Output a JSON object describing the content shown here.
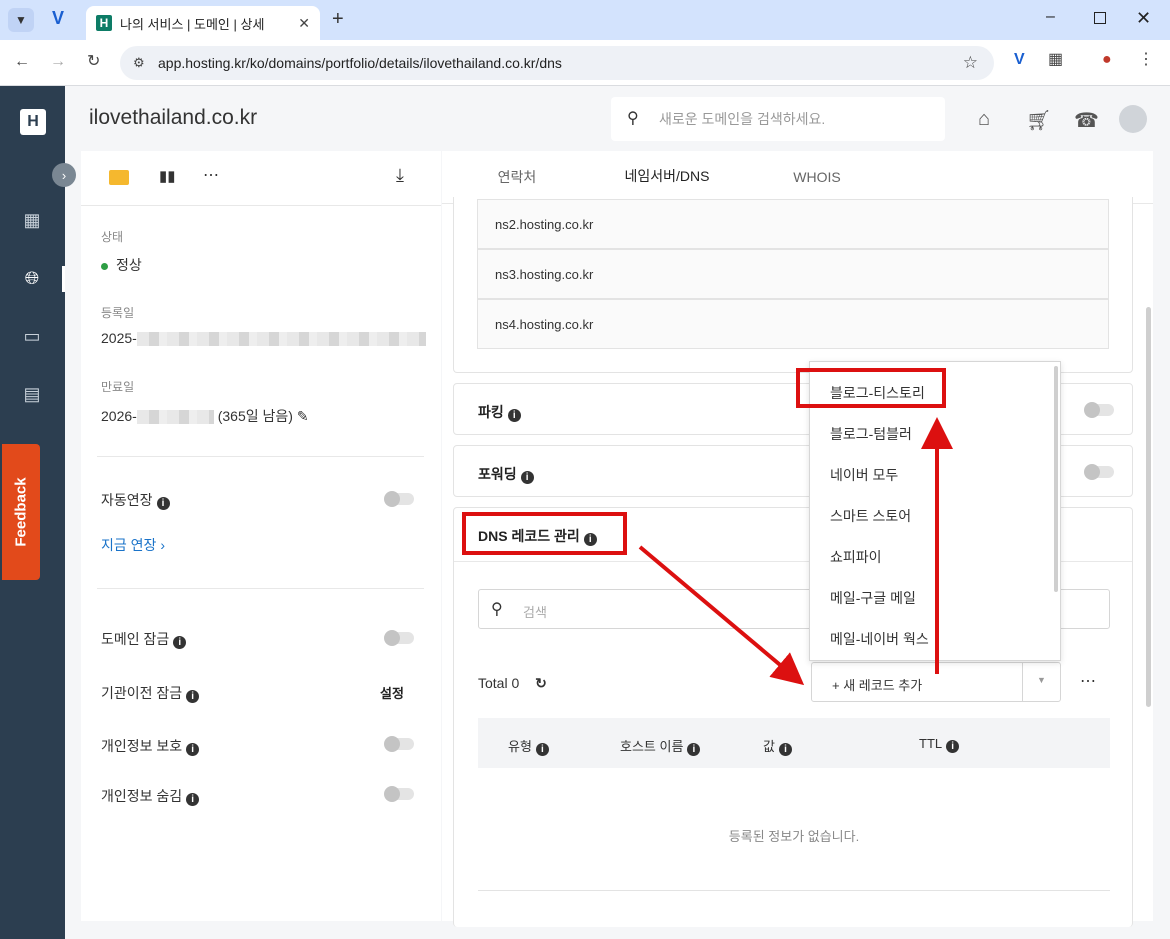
{
  "browser": {
    "tab_title": "나의 서비스 | 도메인 | 상세",
    "tab_favicon": "H",
    "url": "app.hosting.kr/ko/domains/portfolio/details/ilovethailand.co.kr/dns"
  },
  "sidebar": {
    "logo": "H",
    "feedback_label": "Feedback"
  },
  "header": {
    "title": "ilovethailand.co.kr",
    "search_placeholder": "새로운 도메인을 검색하세요."
  },
  "info_panel": {
    "status_label": "상태",
    "status_value": "정상",
    "registered_label": "등록일",
    "registered_value": "2025-",
    "expiry_label": "만료일",
    "expiry_value": "2026-",
    "expiry_remaining": "(365일 남음)",
    "auto_renew_label": "자동연장",
    "renew_now_link": "지금 연장",
    "domain_lock_label": "도메인 잠금",
    "transfer_lock_label": "기관이전 잠금",
    "transfer_lock_action": "설정",
    "privacy_label": "개인정보 보호",
    "privacy_hide_label": "개인정보 숨김"
  },
  "tabs": [
    "연락처",
    "네임서버/DNS",
    "WHOIS"
  ],
  "nameservers": [
    "ns2.hosting.co.kr",
    "ns3.hosting.co.kr",
    "ns4.hosting.co.kr"
  ],
  "sections": {
    "parking": "파킹",
    "forwarding": "포워딩",
    "dns": "DNS 레코드 관리"
  },
  "dns": {
    "search_placeholder": "검색",
    "total": "Total 0",
    "add_record": "+ 새 레코드 추가",
    "columns": [
      "유형",
      "호스트 이름",
      "값",
      "TTL"
    ],
    "empty_message": "등록된 정보가 없습니다."
  },
  "dropdown_items": [
    "블로그-티스토리",
    "블로그-텀블러",
    "네이버 모두",
    "스마트 스토어",
    "쇼피파이",
    "메일-구글 메일",
    "메일-네이버 웍스"
  ],
  "colors": {
    "sidebar": "#2c3e50",
    "highlight": "#dc1010",
    "feedback": "#e24a1b",
    "status_ok": "#2e9e44"
  }
}
